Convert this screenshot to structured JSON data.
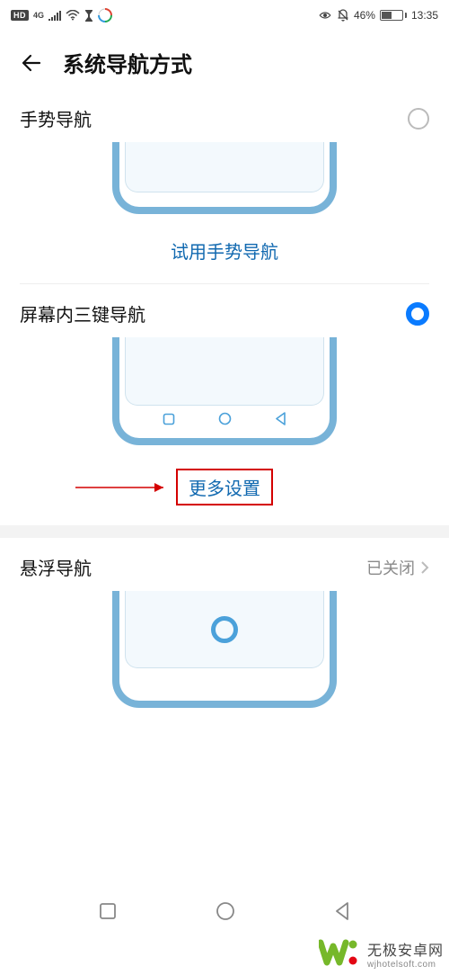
{
  "status": {
    "hd": "HD",
    "net": "4G",
    "battery_pct": "46%",
    "time": "13:35"
  },
  "header": {
    "title": "系统导航方式"
  },
  "options": {
    "gesture": {
      "label": "手势导航",
      "try_link": "试用手势导航"
    },
    "three_key": {
      "label": "屏幕内三键导航",
      "more_link": "更多设置"
    },
    "float": {
      "label": "悬浮导航",
      "status": "已关闭"
    }
  },
  "watermark": {
    "name": "无极安卓网",
    "url": "wjhotelsoft.com"
  }
}
